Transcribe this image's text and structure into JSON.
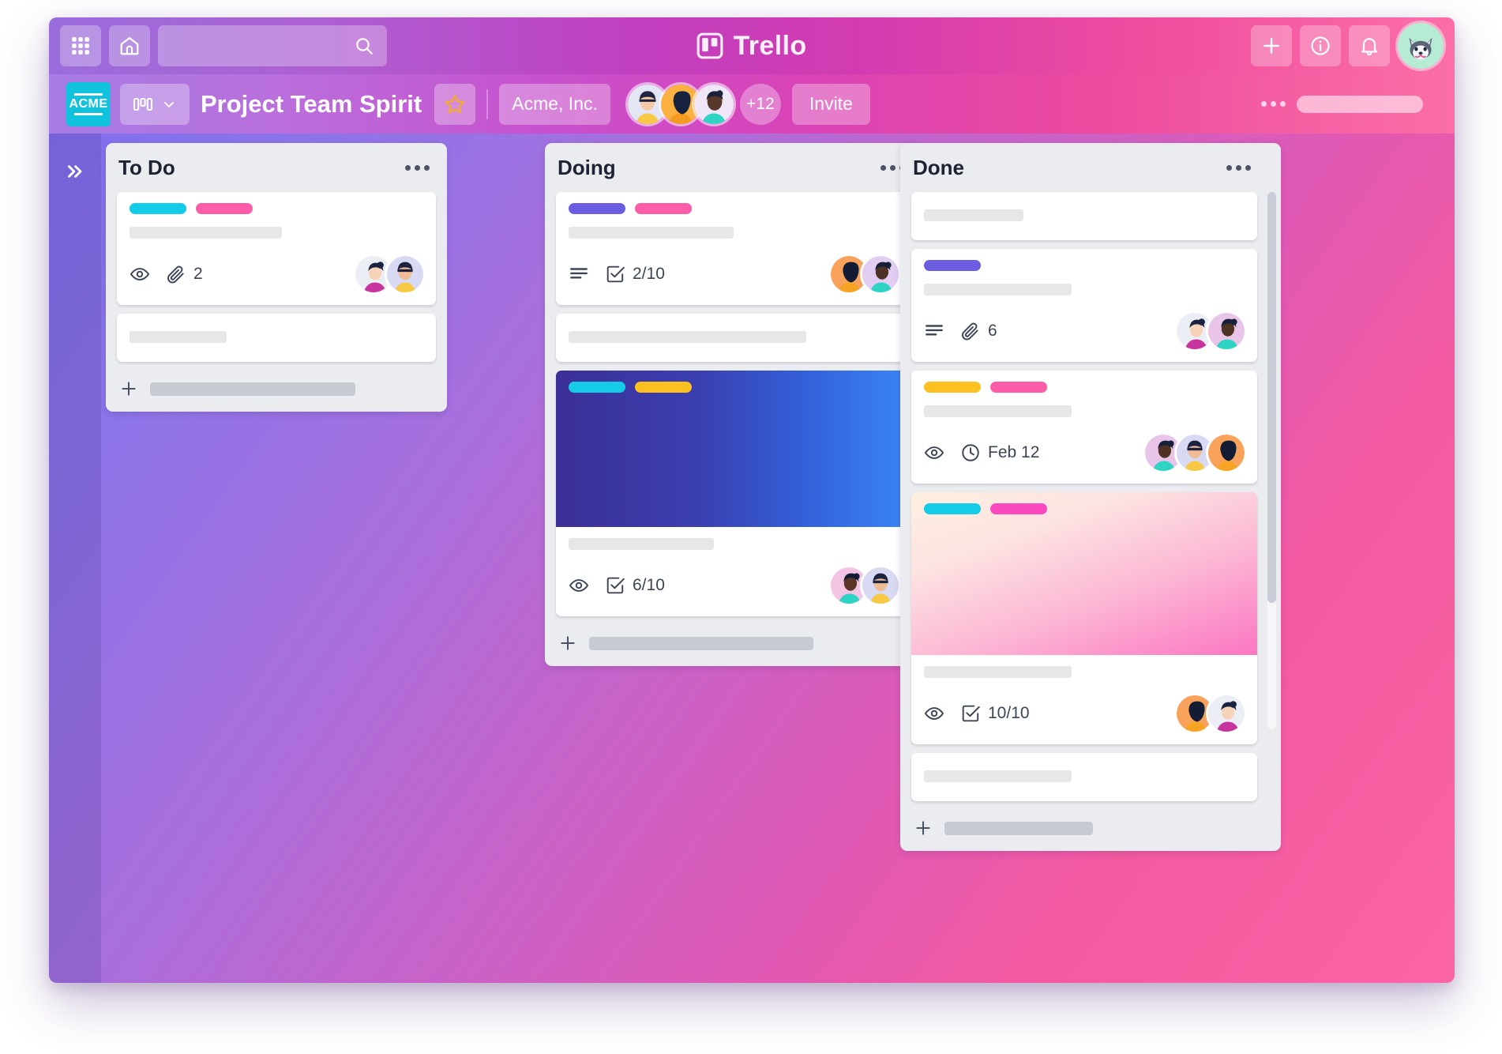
{
  "app": {
    "name": "Trello",
    "logo_icon": "trello-board-icon"
  },
  "top_bar": {
    "apps_grid_icon": "apps-grid-icon",
    "home_icon": "home-icon",
    "search": {
      "value": "",
      "placeholder": "",
      "icon": "search-icon"
    },
    "add_icon": "plus-icon",
    "info_icon": "info-circle-icon",
    "notifications_icon": "bell-icon",
    "avatar_icon": "husky-avatar",
    "avatar_bg": "#b6ecd4",
    "gradient_from": "#9a6ddb",
    "gradient_to": "#fb6fa8"
  },
  "board_header": {
    "workspace_logo_text": "ACME",
    "workspace_logo_bg": "#11c2dd",
    "board_switcher_icon": "board-columns-icon",
    "board_switcher_chevron": "chevron-down-icon",
    "board_title": "Project Team Spirit",
    "star_icon": "star-icon",
    "star_color": "#f2a93b",
    "team_name": "Acme, Inc.",
    "members_overflow": "+12",
    "invite_label": "Invite",
    "menu_icon": "ellipsis-icon",
    "members": [
      {
        "name": "member-avatar-1",
        "bg": "#e3e6f5",
        "shirt": "#f7c944",
        "hair": "#1f2440",
        "skin": "#f3c9a8"
      },
      {
        "name": "member-avatar-2",
        "bg": "#fbb040",
        "shirt": "#f59a20",
        "hair": "#16213d",
        "skin": "#7a4a2b"
      },
      {
        "name": "member-avatar-3",
        "bg": "#efe7f8",
        "shirt": "#2fd3c4",
        "hair": "#1a2138",
        "skin": "#58382a"
      }
    ]
  },
  "sidebar": {
    "expand_icon": "double-chevron-right-icon"
  },
  "lists": [
    {
      "id": "todo",
      "title": "To Do",
      "menu_icon": "ellipsis-icon",
      "add_card_icon": "plus-icon",
      "add_card_label": "",
      "cards": [
        {
          "id": "todo-card-1",
          "labels": [
            "#14cbe8",
            "#fc5ca8"
          ],
          "title_placeholder_width": "52%",
          "badges": [
            {
              "icon": "eye-icon",
              "text": ""
            },
            {
              "icon": "paperclip-icon",
              "text": "2"
            }
          ],
          "avatars": [
            {
              "name": "card-avatar-a",
              "bg": "#eceef6",
              "shirt": "#c7349e",
              "hair": "#1c2340",
              "skin": "#f6d3b8"
            },
            {
              "name": "card-avatar-b",
              "bg": "#d8d9f2",
              "shirt": "#f7c944",
              "hair": "#1c2340",
              "skin": "#f0bc96"
            }
          ]
        },
        {
          "id": "todo-card-2",
          "labels": [],
          "title_placeholder_width": "33%",
          "badges": [],
          "avatars": []
        }
      ]
    },
    {
      "id": "doing",
      "title": "Doing",
      "menu_icon": "ellipsis-icon",
      "add_card_icon": "plus-icon",
      "add_card_label": "",
      "cards": [
        {
          "id": "doing-card-1",
          "labels": [
            "#6c5ce0",
            "#fc5ca8"
          ],
          "title_placeholder_width": "50%",
          "badges": [
            {
              "icon": "description-lines-icon",
              "text": ""
            },
            {
              "icon": "checklist-icon",
              "text": "2/10"
            }
          ],
          "avatars": [
            {
              "name": "card-avatar-c",
              "bg": "#f9a25b",
              "shirt": "#f7a425",
              "hair": "#141c34",
              "skin": "#6a4028"
            },
            {
              "name": "card-avatar-d",
              "bg": "#e2cdf3",
              "shirt": "#2fd3c4",
              "hair": "#16203a",
              "skin": "#4e3224"
            }
          ]
        },
        {
          "id": "doing-card-2",
          "labels": [],
          "title_placeholder_width": "72%",
          "badges": [],
          "avatars": []
        },
        {
          "id": "doing-card-3",
          "cover": {
            "type": "gradient",
            "from": "#3b2f96",
            "to": "#3a86f7",
            "name": "blue-gradient-cover"
          },
          "labels": [
            "#14cbe8",
            "#fcc021"
          ],
          "title_placeholder_width": "44%",
          "badges": [
            {
              "icon": "eye-icon",
              "text": ""
            },
            {
              "icon": "checklist-icon",
              "text": "6/10"
            }
          ],
          "avatars": [
            {
              "name": "card-avatar-e",
              "bg": "#f3c4e4",
              "shirt": "#2fd3c4",
              "hair": "#141c34",
              "skin": "#5a3526"
            },
            {
              "name": "card-avatar-f",
              "bg": "#d8d9f2",
              "shirt": "#f7c944",
              "hair": "#1c2340",
              "skin": "#f0bc96"
            }
          ]
        }
      ]
    },
    {
      "id": "done",
      "title": "Done",
      "menu_icon": "ellipsis-icon",
      "add_card_icon": "plus-icon",
      "add_card_label": "",
      "scrollbar": true,
      "cards": [
        {
          "id": "done-card-1",
          "labels": [],
          "title_placeholder_width": "31%",
          "badges": [],
          "avatars": []
        },
        {
          "id": "done-card-2",
          "labels": [
            "#6c5ce0"
          ],
          "title_placeholder_width": "46%",
          "badges": [
            {
              "icon": "description-lines-icon",
              "text": ""
            },
            {
              "icon": "paperclip-icon",
              "text": "6"
            }
          ],
          "avatars": [
            {
              "name": "card-avatar-g",
              "bg": "#eceef6",
              "shirt": "#c7349e",
              "hair": "#1c2340",
              "skin": "#f6d3b8"
            },
            {
              "name": "card-avatar-h",
              "bg": "#e8c5e8",
              "shirt": "#2fd3c4",
              "hair": "#16203a",
              "skin": "#4e3224"
            }
          ]
        },
        {
          "id": "done-card-3",
          "labels": [
            "#fcc021",
            "#fc5ca8"
          ],
          "title_placeholder_width": "46%",
          "badges": [
            {
              "icon": "eye-icon",
              "text": ""
            },
            {
              "icon": "clock-icon",
              "text": "Feb 12"
            }
          ],
          "avatars": [
            {
              "name": "card-avatar-i",
              "bg": "#e8c5e8",
              "shirt": "#2fd3c4",
              "hair": "#16203a",
              "skin": "#4e3224"
            },
            {
              "name": "card-avatar-j",
              "bg": "#d8d9f2",
              "shirt": "#f7c944",
              "hair": "#1c2340",
              "skin": "#f0bc96"
            },
            {
              "name": "card-avatar-k",
              "bg": "#f9a25b",
              "shirt": "#f7a425",
              "hair": "#141c34",
              "skin": "#6a4028"
            }
          ]
        },
        {
          "id": "done-card-4",
          "cover": {
            "type": "gradient",
            "from": "#fdf0e0",
            "to": "#fb76c2",
            "name": "pink-gradient-cover"
          },
          "labels": [
            "#14cbe8",
            "#fb49c0"
          ],
          "title_placeholder_width": "46%",
          "badges": [
            {
              "icon": "eye-icon",
              "text": ""
            },
            {
              "icon": "checklist-icon",
              "text": "10/10"
            }
          ],
          "avatars": [
            {
              "name": "card-avatar-l",
              "bg": "#f9a25b",
              "shirt": "#f7a425",
              "hair": "#141c34",
              "skin": "#6a4028"
            },
            {
              "name": "card-avatar-m",
              "bg": "#eceef6",
              "shirt": "#c7349e",
              "hair": "#1c2340",
              "skin": "#f6d3b8"
            }
          ]
        },
        {
          "id": "done-card-5",
          "labels": [],
          "title_placeholder_width": "46%",
          "badges": [],
          "avatars": []
        }
      ]
    }
  ],
  "colors": {
    "board_bg_from": "#7b6ef0",
    "board_bg_to": "#fb64a6",
    "list_bg": "#ebecef",
    "card_bg": "#ffffff",
    "text_dark": "#1d2333"
  }
}
